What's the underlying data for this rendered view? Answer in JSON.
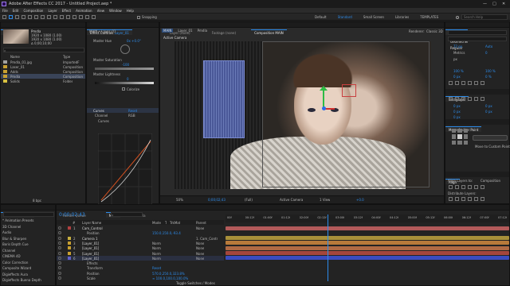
{
  "title": "Adobe After Effects CC 2017 - Untitled Project.aep *",
  "menu": [
    "File",
    "Edit",
    "Composition",
    "Layer",
    "Effect",
    "Animation",
    "View",
    "Window",
    "Help"
  ],
  "toolbar": {
    "snapping": "Snapping",
    "workspaces": [
      "Default",
      "Standard",
      "Small Screen",
      "Libraries",
      "TEMPLATES"
    ],
    "search_placeholder": "Search Help"
  },
  "project": {
    "tab": "Project",
    "thumb_name": "Pmdla",
    "thumb_info": [
      "1920 x 1080 (1.00)",
      "1920 x 1080 (1.00)",
      "∆ 0;00;10;00"
    ],
    "search_placeholder": "ρ",
    "col_name": "Name",
    "col_type": "Type",
    "items": [
      {
        "name": "Pmdla_01.jpg",
        "type": "ImportedF",
        "color": "#a0a0a0"
      },
      {
        "name": "Laser_01",
        "type": "Composition",
        "color": "#c8a030"
      },
      {
        "name": "Adds",
        "type": "Composition",
        "color": "#c8a030"
      },
      {
        "name": "Pmdla",
        "type": "Composition",
        "color": "#c8a030"
      },
      {
        "name": "Solids",
        "type": "Folder",
        "color": "#d7c040"
      }
    ],
    "footer": "8 bpc"
  },
  "effects": {
    "tab": "Effect Controls",
    "tab_layer": "Layer_01",
    "header": "MAIN • Layer_01",
    "hue_label": "Master Hue",
    "hue_value": "0x +0.0°",
    "sat_label": "Master Saturation",
    "sat_value": "-100",
    "light_label": "Master Lightness",
    "light_value": "0",
    "colorize_label": "Colorize",
    "curves_label": "Curves",
    "curves_reset": "Reset",
    "channel_label": "Channel",
    "channel_value": "RGB",
    "curves_sub": "Curves",
    "curve_buttons": [
      "Open...",
      "Auto",
      "Res"
    ],
    "curve_footer": [
      "Save...",
      "Smooth"
    ]
  },
  "viewer": {
    "tabs": [
      "Layer (none)",
      "Footage (none)",
      "Composition MAIN"
    ],
    "breadcrumb": [
      "MAIN",
      "Layer_01",
      "Pmdla"
    ],
    "renderer_label": "Renderer:",
    "renderer": "Classic 3D",
    "active_camera": "Active Camera",
    "footer": [
      "50%",
      "0;00;02;43",
      "(Full)",
      "Active Camera",
      "1 View",
      "+0.0"
    ]
  },
  "right_panel": {
    "character_tab": "Character",
    "font": "Geometriel",
    "style": "Regular",
    "size": "72 px",
    "leading": "Auto",
    "tracking": "0",
    "kerning": "Metrics",
    "scale_v": "100 %",
    "scale_h": "100 %",
    "baseline": "0 px",
    "tsume": "0 %",
    "px_label": "px",
    "paragraph_tab": "Paragraph",
    "para_values": [
      "0 px",
      "0 px",
      "0 px",
      "0 px",
      "0 px"
    ],
    "puppet_tab": "Move Anchor Point",
    "puppet_button": "Move to Custom Point",
    "align_tab": "Align",
    "align_label": "Align Layers to:",
    "align_target": "Composition",
    "distribute_label": "Distribute Layers:"
  },
  "effects_presets": {
    "tab": "Effects & Presets",
    "items": [
      "* Animation Presets",
      "3D Channel",
      "Audio",
      "Blur & Sharpen",
      "Boris Depth Cue",
      "Channel",
      "CINEMA 4D",
      "Color Correction",
      "Composite Wizard",
      "Digieffects Aura",
      "Digieffects Buena Depth"
    ]
  },
  "timeline": {
    "tabs": [
      "Render Queue",
      "MAIN",
      "Pmdla"
    ],
    "timecode": "0:00:02:43",
    "search_placeholder": "ρ",
    "col_headers": [
      "#",
      "Layer Name",
      "Mode",
      "T",
      "TrkMat",
      "Parent"
    ],
    "ruler": [
      "00f",
      "00:12f",
      "01:00f",
      "01:12f",
      "02:00f",
      "02:12f",
      "03:00f",
      "03:12f",
      "04:00f",
      "04:12f",
      "05:00f",
      "05:12f",
      "06:00f",
      "06:12f",
      "07:00f",
      "07:12f"
    ],
    "layers": [
      {
        "num": "1",
        "name": "Cam_Control",
        "color": "#b04040",
        "mode": "",
        "parent": "None",
        "bar": "#b35a5a",
        "start": 0.0,
        "end": 1.0
      },
      {
        "num": "",
        "name": "Position",
        "color": "",
        "mode": "",
        "parent": "150.0,150.0,-93.4",
        "bar": "",
        "start": 0,
        "end": 0
      },
      {
        "num": "2",
        "name": "Camera 1",
        "color": "#c8b040",
        "mode": "",
        "parent": "1. Cam_Contr",
        "bar": "#a8903a",
        "start": 0.0,
        "end": 1.0
      },
      {
        "num": "3",
        "name": "[Layer_01]",
        "color": "#c8a030",
        "mode": "Norm",
        "parent": "None",
        "bar": "#b87a3a",
        "start": 0.0,
        "end": 1.0
      },
      {
        "num": "4",
        "name": "[Layer_01]",
        "color": "#c8a030",
        "mode": "Norm",
        "parent": "None",
        "bar": "#b06a44",
        "start": 0.0,
        "end": 1.0
      },
      {
        "num": "5",
        "name": "[Layer_01]",
        "color": "#c8a030",
        "mode": "Norm",
        "parent": "None",
        "bar": "#a4463c",
        "start": 0.0,
        "end": 1.0
      },
      {
        "num": "6",
        "name": "[Layer_01]",
        "color": "#6060c8",
        "mode": "Norm",
        "parent": "None",
        "bar": "#3a4cc0",
        "start": 0.0,
        "end": 1.0
      },
      {
        "num": "",
        "name": "Effects",
        "color": "",
        "mode": "",
        "parent": "",
        "bar": "",
        "start": 0,
        "end": 0
      },
      {
        "num": "",
        "name": "Transform",
        "color": "",
        "mode": "",
        "parent": "Reset",
        "bar": "",
        "start": 0,
        "end": 0
      },
      {
        "num": "",
        "name": "Position",
        "color": "",
        "mode": "",
        "parent": "570.0,250.0,323.8%",
        "bar": "",
        "start": 0,
        "end": 0
      },
      {
        "num": "",
        "name": "Scale",
        "color": "",
        "mode": "",
        "parent": "∞ 100.0,100.0,100.0%",
        "bar": "",
        "start": 0,
        "end": 0
      }
    ],
    "footer": "Toggle Switches / Modes",
    "playhead": 0.36
  }
}
